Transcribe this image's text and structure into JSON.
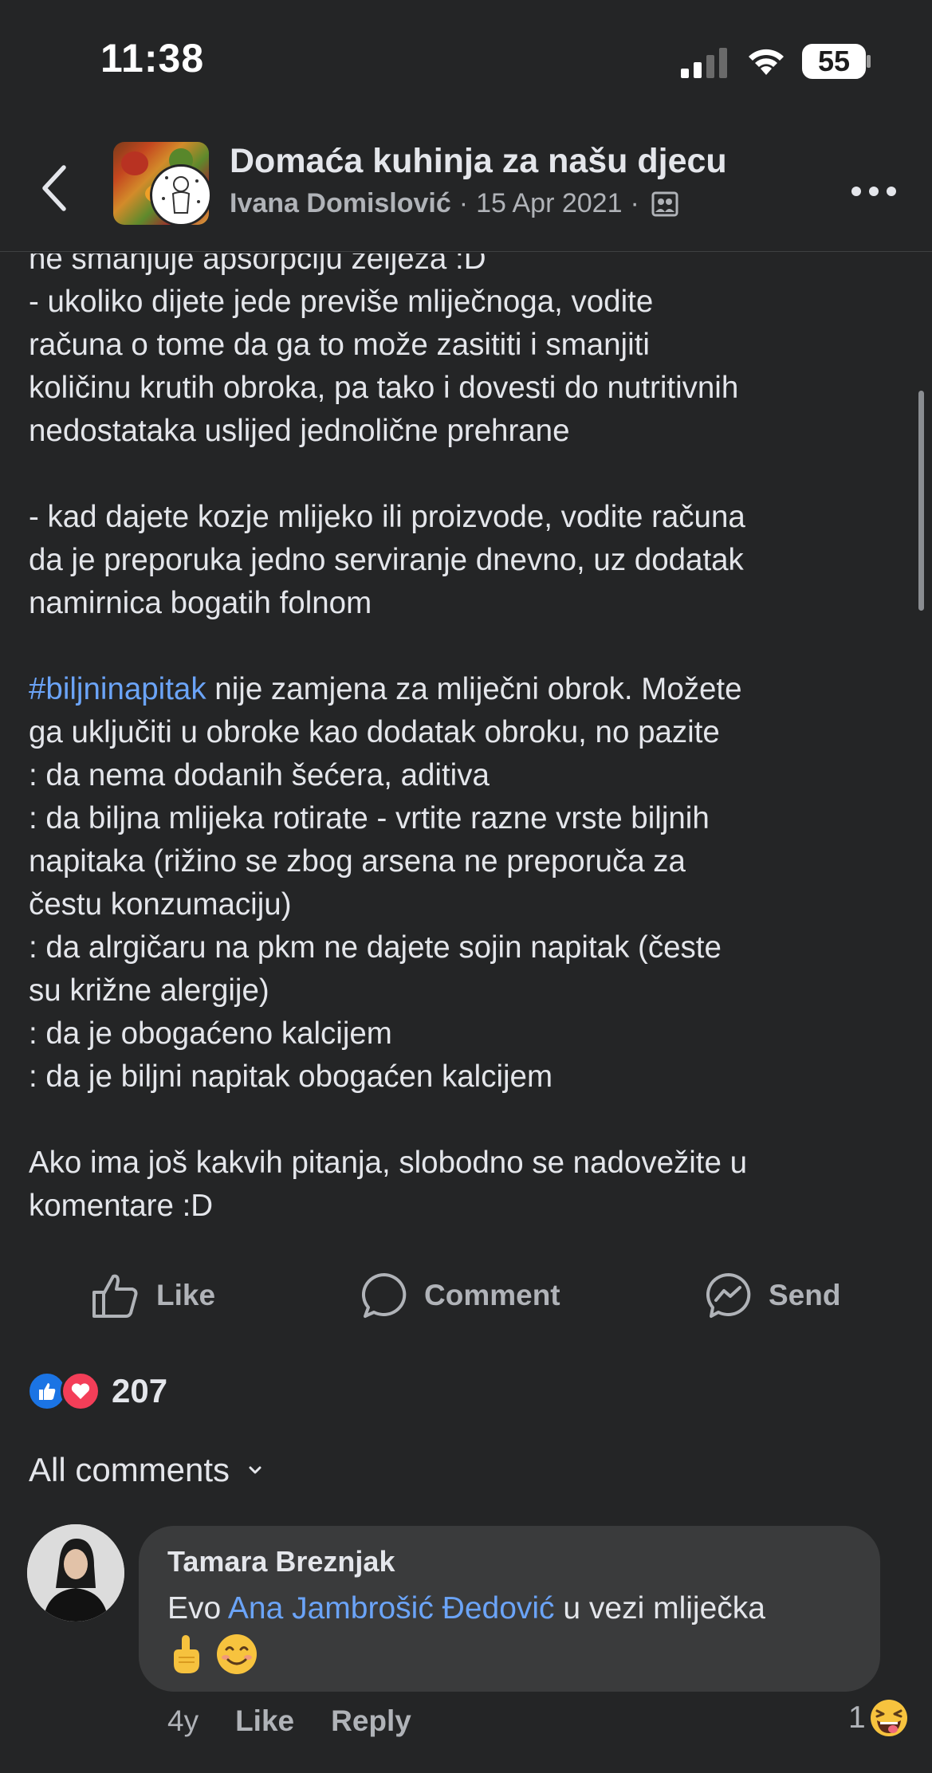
{
  "status_bar": {
    "time": "11:38",
    "battery": "55",
    "icons": [
      "signal-icon",
      "wifi-icon",
      "battery-icon"
    ]
  },
  "header": {
    "group_name": "Domaća kuhinja za našu djecu",
    "author": "Ivana Domislović",
    "separator": "·",
    "date": "15 Apr 2021",
    "icons": [
      "back-icon",
      "members-icon",
      "more-icon"
    ]
  },
  "post": {
    "lines": [
      "ne smanjuje apsorpciju željeza :D",
      "- ukoliko dijete jede previše mliječnoga, vodite",
      "računa o tome da ga to može zasititi i smanjiti",
      "količinu krutih obroka, pa tako i dovesti do nutritivnih",
      "nedostataka uslijed jednolične prehrane",
      "- kad dajete kozje mlijeko ili proizvode, vodite računa",
      "da je preporuka jedno serviranje dnevno, uz dodatak",
      "namirnica bogatih folnom",
      "#biljninapitak",
      " nije zamjena za mliječni obrok. Možete",
      "ga uključiti u obroke kao dodatak obroku, no pazite",
      ":  da nema dodanih šećera, aditiva",
      ": da biljna mlijeka rotirate - vrtite razne vrste biljnih",
      "napitaka  (rižino se zbog arsena ne preporuča za",
      "čestu konzumaciju)",
      ": da alrgičaru na pkm ne dajete sojin napitak (česte",
      "su križne alergije)",
      ": da je obogaćeno kalcijem",
      ": da je biljni napitak obogaćen kalcijem",
      "Ako ima još kakvih pitanja, slobodno se nadovežite u",
      "komentare :D"
    ]
  },
  "actions": {
    "like": "Like",
    "comment": "Comment",
    "send": "Send"
  },
  "reactions": {
    "count": "207",
    "types": [
      "like",
      "love"
    ],
    "colors": {
      "like": "#1b74e4",
      "love": "#f33e58"
    }
  },
  "comments": {
    "filter_label": "All comments",
    "items": [
      {
        "author": "Tamara Breznjak",
        "text_before": "Evo ",
        "mention": "Ana Jambrošić Đedović",
        "text_after": " u vezi mliječka",
        "emojis": [
          "☝",
          "😊"
        ],
        "age": "4y",
        "like": "Like",
        "reply": "Reply",
        "reaction_count": "1",
        "reaction_emoji": "😝"
      }
    ]
  },
  "colors": {
    "background": "#242526",
    "bubble": "#3a3b3c",
    "link": "#6ba4f8",
    "text": "#e4e6eb",
    "muted": "#b0b3b8"
  }
}
